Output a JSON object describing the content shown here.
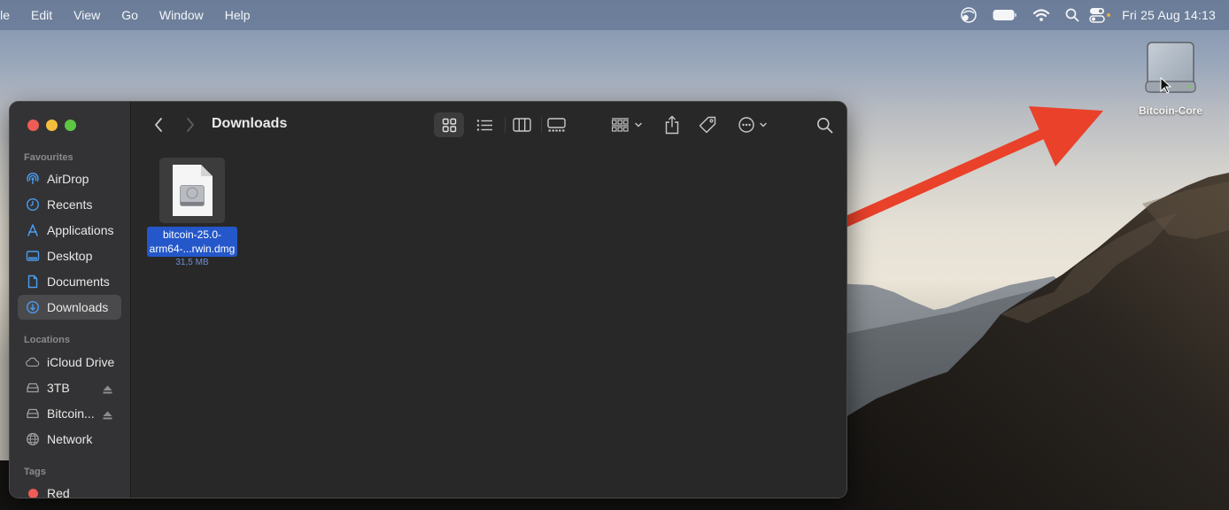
{
  "menubar": {
    "items": [
      "ile",
      "Edit",
      "View",
      "Go",
      "Window",
      "Help"
    ],
    "status_icons": [
      "screen-time-icon",
      "battery-icon",
      "wifi-icon",
      "spotlight-search-icon",
      "control-center-icon"
    ],
    "clock": "Fri 25 Aug  14:13"
  },
  "desktop": {
    "drive_label": "Bitcoin-Core",
    "annotation": {
      "type": "arrow",
      "color": "#e9412a",
      "points_to": "Bitcoin-Core drive icon"
    }
  },
  "finder": {
    "title": "Downloads",
    "sidebar": {
      "sections": [
        {
          "title": "Favourites",
          "items": [
            {
              "label": "AirDrop",
              "icon": "airdrop-icon"
            },
            {
              "label": "Recents",
              "icon": "clock-icon"
            },
            {
              "label": "Applications",
              "icon": "applications-icon"
            },
            {
              "label": "Desktop",
              "icon": "desktop-icon"
            },
            {
              "label": "Documents",
              "icon": "document-icon"
            },
            {
              "label": "Downloads",
              "icon": "download-icon",
              "active": true
            }
          ]
        },
        {
          "title": "Locations",
          "items": [
            {
              "label": "iCloud Drive",
              "icon": "cloud-icon"
            },
            {
              "label": "3TB",
              "icon": "drive-icon",
              "ejectable": true
            },
            {
              "label": "Bitcoin...",
              "icon": "drive-icon",
              "ejectable": true
            },
            {
              "label": "Network",
              "icon": "globe-icon"
            }
          ]
        },
        {
          "title": "Tags",
          "items": [
            {
              "label": "Red",
              "icon": "tag-dot-icon",
              "color": "#ee5c55"
            }
          ]
        }
      ]
    },
    "toolbar": {
      "back": "back-icon",
      "forward": "forward-icon",
      "views": [
        "icon-view",
        "list-view",
        "column-view",
        "gallery-view"
      ],
      "active_view": "icon-view",
      "actions": [
        "group-by-icon",
        "share-icon",
        "tag-icon",
        "more-actions-icon",
        "search-icon"
      ]
    },
    "files": [
      {
        "name_line1": "bitcoin-25.0-",
        "name_line2": "arm64-...rwin.dmg",
        "size": "31,5 MB",
        "selected": true
      }
    ]
  }
}
